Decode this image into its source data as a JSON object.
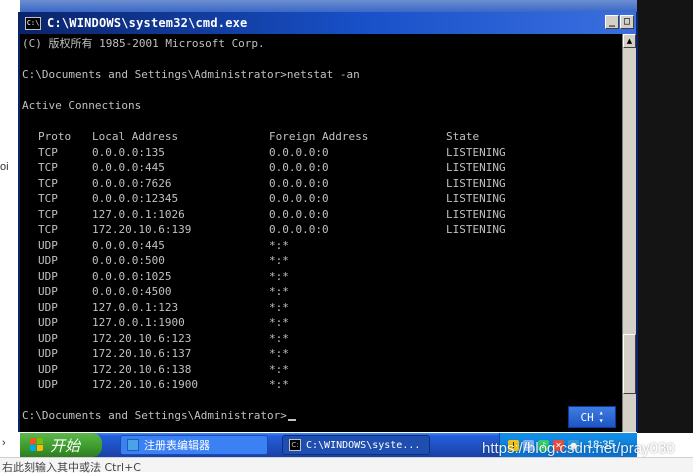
{
  "window": {
    "title": "C:\\WINDOWS\\system32\\cmd.exe",
    "buttons": {
      "minimize": "_",
      "maximize": "□"
    }
  },
  "console": {
    "copyright": "(C) 版权所有 1985-2001 Microsoft Corp.",
    "prompt1": "C:\\Documents and Settings\\Administrator>netstat -an",
    "active_connections": "Active Connections",
    "headers": {
      "proto": "Proto",
      "local": "Local Address",
      "foreign": "Foreign Address",
      "state": "State"
    },
    "rows": [
      {
        "proto": "TCP",
        "local": "0.0.0.0:135",
        "foreign": "0.0.0.0:0",
        "state": "LISTENING"
      },
      {
        "proto": "TCP",
        "local": "0.0.0.0:445",
        "foreign": "0.0.0.0:0",
        "state": "LISTENING"
      },
      {
        "proto": "TCP",
        "local": "0.0.0.0:7626",
        "foreign": "0.0.0.0:0",
        "state": "LISTENING"
      },
      {
        "proto": "TCP",
        "local": "0.0.0.0:12345",
        "foreign": "0.0.0.0:0",
        "state": "LISTENING"
      },
      {
        "proto": "TCP",
        "local": "127.0.0.1:1026",
        "foreign": "0.0.0.0:0",
        "state": "LISTENING"
      },
      {
        "proto": "TCP",
        "local": "172.20.10.6:139",
        "foreign": "0.0.0.0:0",
        "state": "LISTENING"
      },
      {
        "proto": "UDP",
        "local": "0.0.0.0:445",
        "foreign": "*:*",
        "state": ""
      },
      {
        "proto": "UDP",
        "local": "0.0.0.0:500",
        "foreign": "*:*",
        "state": ""
      },
      {
        "proto": "UDP",
        "local": "0.0.0.0:1025",
        "foreign": "*:*",
        "state": ""
      },
      {
        "proto": "UDP",
        "local": "0.0.0.0:4500",
        "foreign": "*:*",
        "state": ""
      },
      {
        "proto": "UDP",
        "local": "127.0.0.1:123",
        "foreign": "*:*",
        "state": ""
      },
      {
        "proto": "UDP",
        "local": "127.0.0.1:1900",
        "foreign": "*:*",
        "state": ""
      },
      {
        "proto": "UDP",
        "local": "172.20.10.6:123",
        "foreign": "*:*",
        "state": ""
      },
      {
        "proto": "UDP",
        "local": "172.20.10.6:137",
        "foreign": "*:*",
        "state": ""
      },
      {
        "proto": "UDP",
        "local": "172.20.10.6:138",
        "foreign": "*:*",
        "state": ""
      },
      {
        "proto": "UDP",
        "local": "172.20.10.6:1900",
        "foreign": "*:*",
        "state": ""
      }
    ],
    "prompt2": "C:\\Documents and Settings\\Administrator>"
  },
  "ime": {
    "label": "CH"
  },
  "taskbar": {
    "start_label": "开始",
    "tasks": [
      {
        "label": "注册表编辑器",
        "icon": "registry-editor-icon",
        "active": false
      },
      {
        "label": "C:\\WINDOWS\\syste...",
        "icon": "cmd-icon",
        "active": true
      }
    ],
    "clock": "18:35"
  },
  "side": {
    "edge_label": "oi"
  },
  "bottom": {
    "text": "右此刻输入其中或法 Ctrl+C"
  },
  "watermark": "https://blog.csdn.net/pray030",
  "colors": {
    "console_bg": "#000000",
    "console_fg": "#c0c0c0",
    "titlebar": "#0a246a",
    "taskbar": "#245edb",
    "start": "#3c9a2d"
  }
}
